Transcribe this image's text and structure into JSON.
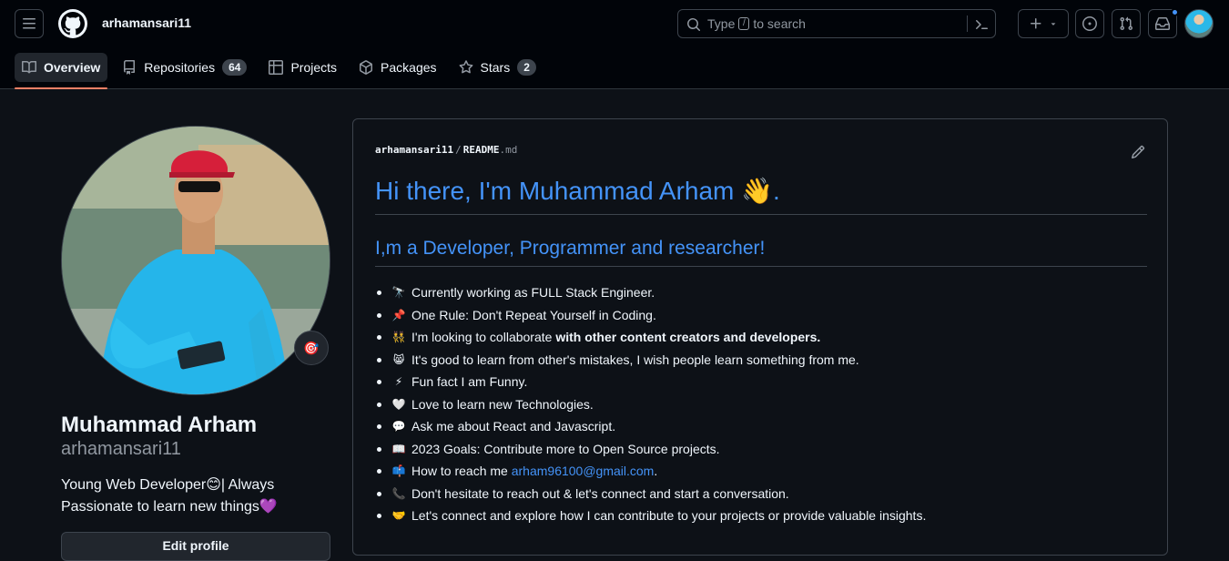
{
  "header": {
    "username": "arhamansari11",
    "search_prefix": "Type",
    "search_key": "/",
    "search_suffix": "to search",
    "plus_label": "+"
  },
  "tabs": [
    {
      "label": "Overview",
      "icon": "book-icon",
      "active": true
    },
    {
      "label": "Repositories",
      "icon": "repo-icon",
      "count": "64"
    },
    {
      "label": "Projects",
      "icon": "table-icon"
    },
    {
      "label": "Packages",
      "icon": "package-icon"
    },
    {
      "label": "Stars",
      "icon": "star-icon",
      "count": "2"
    }
  ],
  "profile": {
    "name": "Muhammad Arham",
    "handle": "arhamansari11",
    "bio": "Young Web Developer😊| Always Passionate to learn new things💜",
    "status_emoji": "🎯",
    "edit_button": "Edit profile"
  },
  "readme": {
    "owner": "arhamansari11",
    "separator": "/",
    "file": "README",
    "ext": ".md",
    "heading": "Hi there, I'm Muhammad Arham 👋.",
    "subheading": "I,m a Developer, Programmer and researcher!",
    "items": [
      {
        "emoji": "🔭",
        "text": "Currently working as FULL Stack Engineer."
      },
      {
        "emoji": "📌",
        "text": "One Rule: Don't Repeat Yourself in Coding."
      },
      {
        "emoji": "👯",
        "text": "I'm looking to collaborate ",
        "bold": "with other content creators and developers."
      },
      {
        "emoji": "😸",
        "text": "It's good to learn from other's mistakes, I wish people learn something from me."
      },
      {
        "emoji": "⚡",
        "text": "Fun fact I am Funny."
      },
      {
        "emoji": "🤍",
        "text": "Love to learn new Technologies."
      },
      {
        "emoji": "💬",
        "text": "Ask me about React and Javascript."
      },
      {
        "emoji": "📖",
        "text": "2023 Goals: Contribute more to Open Source projects."
      },
      {
        "emoji": "📫",
        "text": "How to reach me ",
        "link": "arham96100@gmail.com",
        "after": "."
      },
      {
        "emoji": "📞",
        "text": "Don't hesitate to reach out & let's connect and start a conversation."
      },
      {
        "emoji": "🤝",
        "text": "Let's connect and explore how I can contribute to your projects or provide valuable insights."
      }
    ]
  }
}
